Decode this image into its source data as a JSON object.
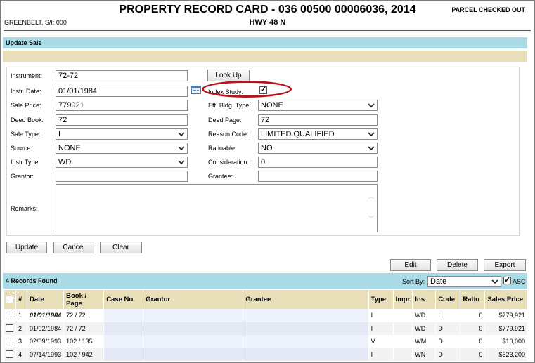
{
  "header": {
    "title": "PROPERTY RECORD CARD - 036 00500 00006036, 2014",
    "address": "HWY 48 N",
    "left_info": "GREENBELT, S/I: 000",
    "status": "PARCEL CHECKED OUT"
  },
  "section": {
    "title": "Update Sale"
  },
  "form": {
    "instrument": {
      "label": "Instrument:",
      "value": "72-72"
    },
    "lookup_button": "Look Up",
    "instr_date": {
      "label": "Instr. Date:",
      "value": "01/01/1984"
    },
    "index_study": {
      "label": "Index Study:",
      "checked": true
    },
    "sale_price": {
      "label": "Sale Price:",
      "value": "779921"
    },
    "eff_bldg_type": {
      "label": "Eff. Bldg. Type:",
      "value": "NONE"
    },
    "deed_book": {
      "label": "Deed Book:",
      "value": "72"
    },
    "deed_page": {
      "label": "Deed Page:",
      "value": "72"
    },
    "sale_type": {
      "label": "Sale Type:",
      "value": "I"
    },
    "reason_code": {
      "label": "Reason Code:",
      "value": "LIMITED QUALIFIED"
    },
    "source": {
      "label": "Source:",
      "value": "NONE"
    },
    "ratioable": {
      "label": "Ratioable:",
      "value": "NO"
    },
    "instr_type": {
      "label": "Instr Type:",
      "value": "WD"
    },
    "consideration": {
      "label": "Consideration:",
      "value": "0"
    },
    "grantor": {
      "label": "Grantor:",
      "value": ""
    },
    "grantee": {
      "label": "Grantee:",
      "value": ""
    },
    "remarks": {
      "label": "Remarks:",
      "value": ""
    }
  },
  "actions": {
    "update": "Update",
    "cancel": "Cancel",
    "clear": "Clear"
  },
  "records_toolbar": {
    "edit": "Edit",
    "delete": "Delete",
    "export": "Export"
  },
  "records": {
    "count_label": "4 Records Found",
    "sort_label": "Sort By:",
    "sort_value": "Date",
    "asc_label": "ASC",
    "asc_checked": true,
    "columns": [
      "#",
      "Date",
      "Book / Page",
      "Case No",
      "Grantor",
      "Grantee",
      "Type",
      "Impr",
      "Ins",
      "Code",
      "Ratio",
      "Sales Price"
    ],
    "rows": [
      {
        "num": "1",
        "date": "01/01/1984",
        "book_page": "72 / 72",
        "case_no": "",
        "grantor": "",
        "grantee": "",
        "type": "I",
        "impr": "",
        "ins": "WD",
        "code": "L",
        "ratio": "0",
        "price": "$779,921"
      },
      {
        "num": "2",
        "date": "01/02/1984",
        "book_page": "72 / 72",
        "case_no": "",
        "grantor": "",
        "grantee": "",
        "type": "I",
        "impr": "",
        "ins": "WD",
        "code": "D",
        "ratio": "0",
        "price": "$779,921"
      },
      {
        "num": "3",
        "date": "02/09/1993",
        "book_page": "102 / 135",
        "case_no": "",
        "grantor": "",
        "grantee": "",
        "type": "V",
        "impr": "",
        "ins": "WM",
        "code": "D",
        "ratio": "0",
        "price": "$10,000"
      },
      {
        "num": "4",
        "date": "07/14/1993",
        "book_page": "102 / 942",
        "case_no": "",
        "grantor": "",
        "grantee": "",
        "type": "I",
        "impr": "",
        "ins": "WN",
        "code": "D",
        "ratio": "0",
        "price": "$623,200"
      }
    ]
  },
  "colors": {
    "section_bar": "#a9dbe6",
    "tan_bar": "#e8dfb8",
    "highlight": "#b8141b"
  }
}
